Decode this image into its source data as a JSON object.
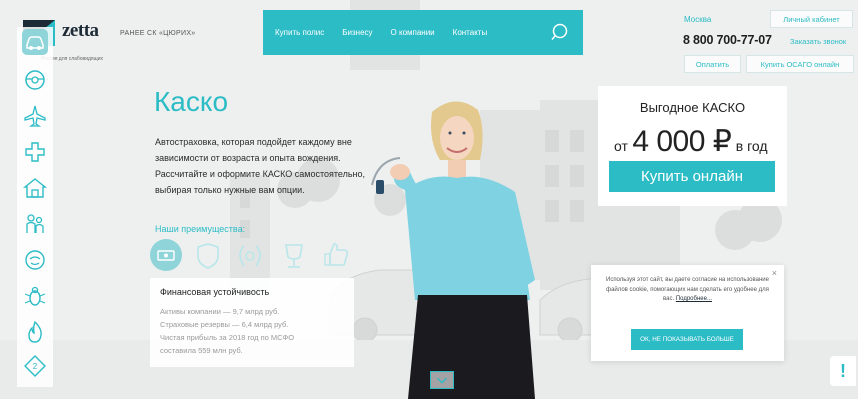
{
  "header": {
    "logo": "zetta",
    "formerly": "РАНЕЕ СК «ЦЮРИХ»",
    "tagline": "Россия для слабовидящих",
    "nav": [
      "Купить полис",
      "Бизнесу",
      "О компании",
      "Контакты"
    ],
    "city": "Москва",
    "cabinet": "Личный кабинет",
    "phone": "8 800 700-77-07",
    "callback": "Заказать звонок",
    "pay": "Оплатить",
    "osago": "Купить ОСАГО онлайн"
  },
  "sidebar": {
    "items": [
      "car-icon",
      "steering-wheel-icon",
      "airplane-icon",
      "medical-cross-icon",
      "house-icon",
      "family-icon",
      "smile-face-icon",
      "bug-icon",
      "fire-icon",
      "road-sign-icon"
    ],
    "active_index": 0
  },
  "hero": {
    "title": "Каско",
    "description": "Автостраховка, которая подойдет каждому вне зависимости от возраста и опыта вождения. Рассчитайте и оформите КАСКО самостоятельно, выбирая только нужные вам опции.",
    "advantages_label": "Наши преимущества:",
    "advantage_icons": [
      "money-stack-icon",
      "shield-icon",
      "laurel-icon",
      "trophy-icon",
      "thumbs-up-icon"
    ]
  },
  "finance": {
    "title": "Финансовая устойчивость",
    "lines": [
      "Активы компании — 9,7 млрд руб.",
      "Страховые резервы — 6,4 млрд руб.",
      "Чистая прибыль за 2018 год по МСФО",
      "составила 559 млн руб."
    ]
  },
  "offer": {
    "title": "Выгодное КАСКО",
    "price_prefix": "от",
    "price_amount": "4 000 ₽",
    "price_suffix": "в год",
    "button": "Купить онлайн"
  },
  "cookie": {
    "text": "Используя этот сайт, вы даете согласие на использование файлов cookie, помогающих нам сделать его удобнее для вас.",
    "link": "Подробнее...",
    "button": "ОК, НЕ ПОКАЗЫВАТЬ БОЛЬШЕ",
    "close": "×"
  },
  "alert": {
    "label": "!"
  },
  "colors": {
    "accent": "#2cbcc6",
    "dark": "#1d2b36",
    "background": "#eef0ef"
  }
}
